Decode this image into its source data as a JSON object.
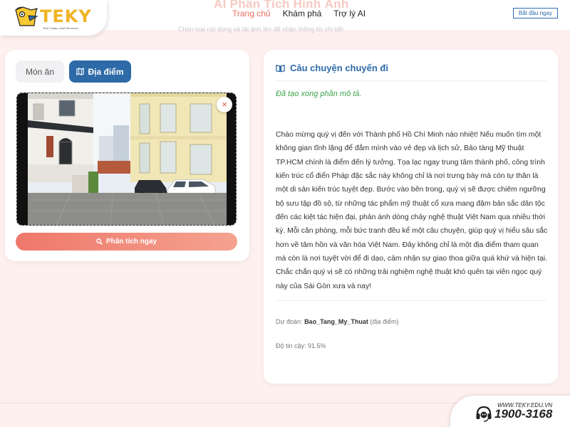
{
  "header": {
    "bg_title": "AI Phân Tích Hình Ảnh",
    "bg_subtitle": "Chọn loại nội dung và tải ảnh lên để nhận thông tin chi tiết",
    "logo_text": "TEKY",
    "logo_tagline": "Tech Today, Lead Tomorrow",
    "nav": [
      "Trang chủ",
      "Khám phá",
      "Trợ lý AI"
    ],
    "start_button": "Bắt đầu ngay"
  },
  "upload": {
    "tabs": {
      "food": "Món ăn",
      "place": "Địa điểm"
    },
    "active_tab": "place",
    "close_symbol": "×",
    "analyze_button": "Phân tích ngay"
  },
  "story": {
    "title": "Câu chuyện chuyến đi",
    "status": "Đã tạo xong phần mô tả.",
    "body": "Chào mừng quý vị đến với Thành phố Hồ Chí Minh náo nhiệt! Nếu muốn tìm một không gian tĩnh lặng để đắm mình vào vẻ đẹp và lịch sử, Bảo tàng Mỹ thuật TP.HCM chính là điểm đến lý tưởng. Tọa lạc ngay trung tâm thành phố, công trình kiến trúc cổ điển Pháp đặc sắc này không chỉ là nơi trưng bày mà còn tự thân là một di sản kiến trúc tuyệt đẹp. Bước vào bên trong, quý vị sẽ được chiêm ngưỡng bộ sưu tập đồ sộ, từ những tác phẩm mỹ thuật cổ xưa mang đậm bản sắc dân tộc đến các kiệt tác hiện đại, phản ánh dòng chảy nghệ thuật Việt Nam qua nhiều thời kỳ. Mỗi căn phòng, mỗi bức tranh đều kể một câu chuyện, giúp quý vị hiểu sâu sắc hơn về tâm hồn và văn hóa Việt Nam. Đây không chỉ là một địa điểm tham quan mà còn là nơi tuyệt vời để đi dạo, cảm nhận sự giao thoa giữa quá khứ và hiện tại. Chắc chắn quý vị sẽ có những trải nghiệm nghệ thuật khó quên tại viên ngọc quý này của Sài Gòn xưa và nay!",
    "prediction_label": "Dự đoán:",
    "prediction_value": "Bao_Tang_My_Thuat",
    "prediction_type": "(địa điểm)",
    "confidence": "Độ tin cậy: 91.5%"
  },
  "footer": {
    "hotline_url": "WWW.TEKY.EDU.VN",
    "hotline_phone": "1900-3168"
  },
  "colors": {
    "accent": "#e8705e",
    "primary": "#2d6aa7",
    "success": "#3ea34a",
    "background": "#fdf0ef"
  }
}
